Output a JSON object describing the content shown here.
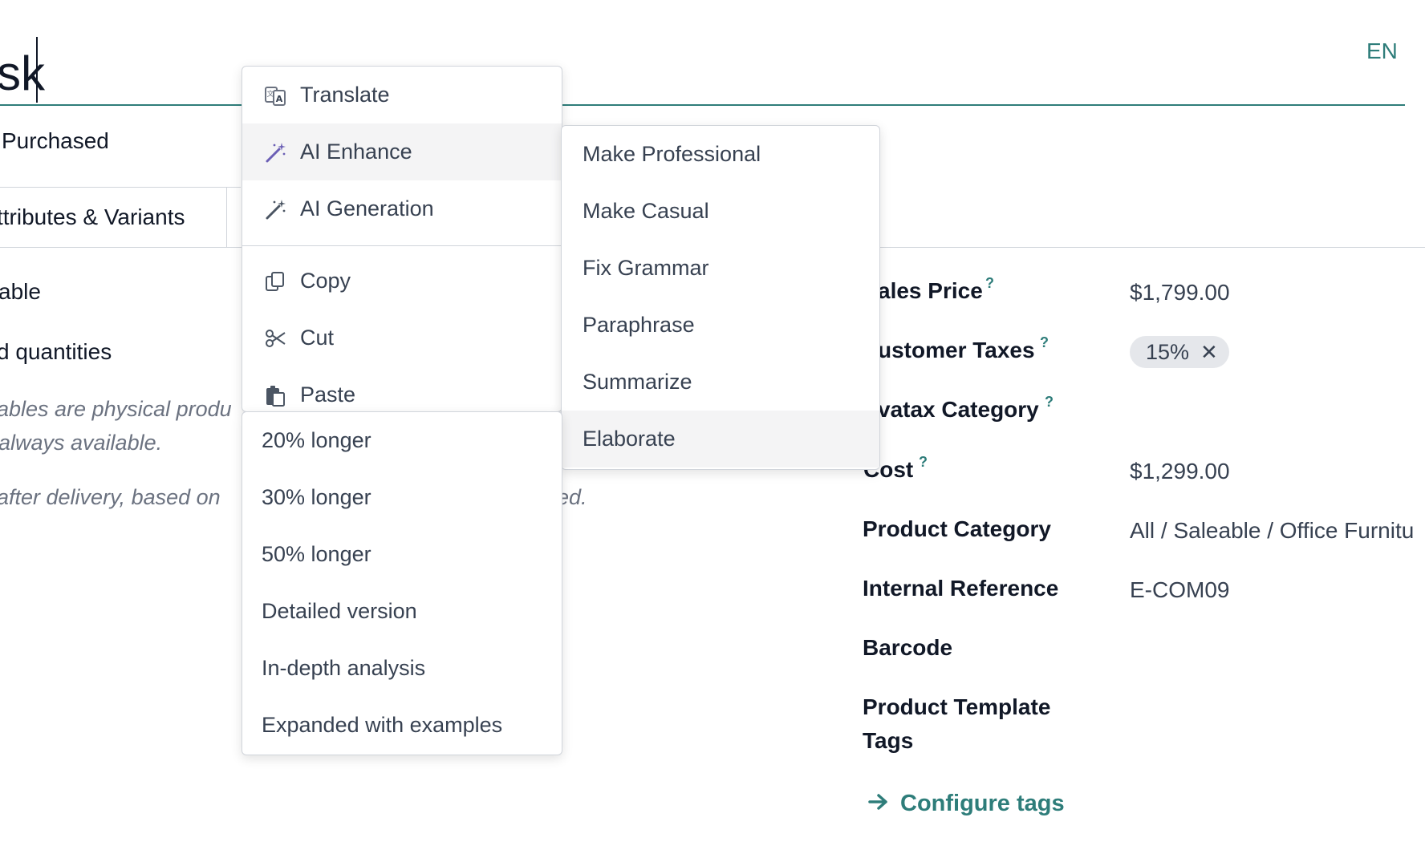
{
  "title": {
    "text": "sk"
  },
  "language_button": "EN",
  "purchased_label": "Purchased",
  "tabs": {
    "attributes_label": "ttributes & Variants"
  },
  "left_fields": {
    "field_1": "able",
    "field_2": "d quantities",
    "note_1a": "ables are physical produ",
    "note_1b": " always available.",
    "note_2a": "after delivery, based on",
    "note_2b": "ed."
  },
  "right_fields": {
    "sales_price": {
      "label": "ales Price",
      "help": "?",
      "value": "$1,799.00"
    },
    "customer_taxes": {
      "label": "ustomer Taxes",
      "help": "?",
      "tag": "15%",
      "tag_remove": "✕"
    },
    "avatax_category": {
      "label": "vatax Category",
      "help": "?"
    },
    "cost": {
      "label": "Cost",
      "help": "?",
      "value": "$1,299.00"
    },
    "product_category": {
      "label": "Product Category",
      "value": "All / Saleable / Office Furnitu"
    },
    "internal_reference": {
      "label": "Internal Reference",
      "value": "E-COM09"
    },
    "barcode": {
      "label": "Barcode"
    },
    "product_template_tags": {
      "label_line1": "Product Template",
      "label_line2": "Tags"
    },
    "configure_tags": "Configure tags"
  },
  "context_menu": {
    "items": [
      {
        "label": "Translate",
        "icon": "translate-icon"
      },
      {
        "label": "AI Enhance",
        "icon": "magic-wand-icon"
      },
      {
        "label": "AI Generation",
        "icon": "magic-wand-icon"
      },
      {
        "label": "Copy",
        "icon": "copy-icon"
      },
      {
        "label": "Cut",
        "icon": "scissors-icon"
      },
      {
        "label": "Paste",
        "icon": "paste-icon"
      }
    ]
  },
  "enhance_submenu": {
    "items": [
      "Make Professional",
      "Make Casual",
      "Fix Grammar",
      "Paraphrase",
      "Summarize",
      "Elaborate"
    ]
  },
  "elaborate_submenu": {
    "items": [
      "20% longer",
      "30% longer",
      "50% longer",
      "Detailed version",
      "In-depth analysis",
      "Expanded with examples"
    ]
  },
  "colors": {
    "accent": "#2e7d7a",
    "menu_hover": "#f4f4f5",
    "badge_bg": "#e5e7eb"
  }
}
